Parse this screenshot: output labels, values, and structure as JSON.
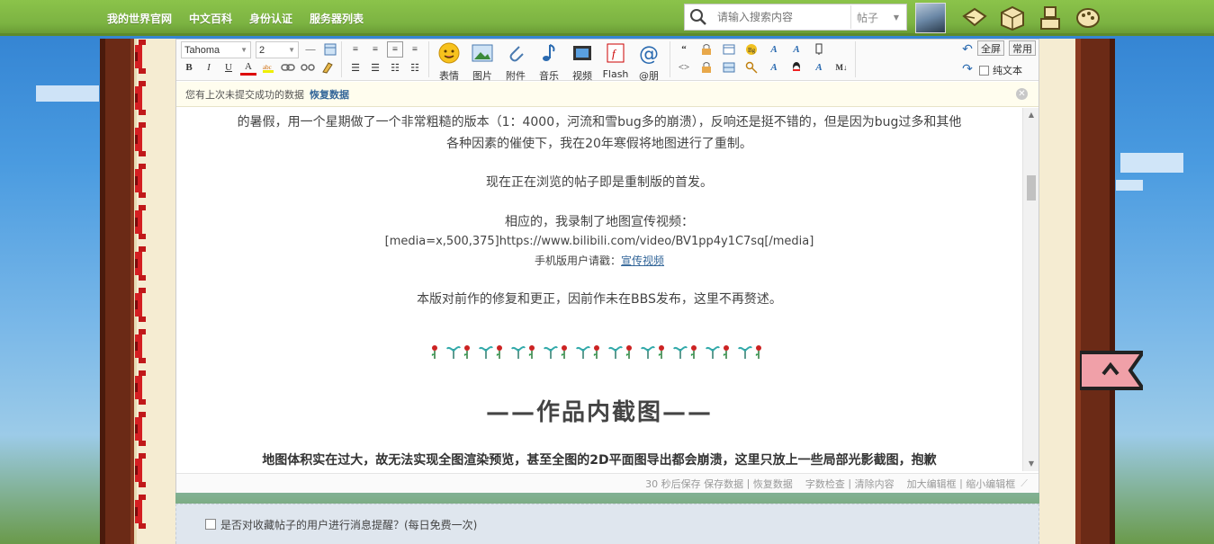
{
  "topnav": {
    "links": [
      "我的世界官网",
      "中文百科",
      "身份认证",
      "服务器列表"
    ],
    "search_placeholder": "请输入搜索内容",
    "search_scope": "帖子"
  },
  "toolbar": {
    "font_family": "Tahoma",
    "font_size": "2",
    "buttons": {
      "bold": "B",
      "italic": "I",
      "underline": "U",
      "color": "A"
    },
    "big_buttons": [
      "表情",
      "图片",
      "附件",
      "音乐",
      "视频",
      "Flash",
      "@朋"
    ],
    "fullscreen": "全屏",
    "common": "常用",
    "plain_text": "纯文本"
  },
  "notice": {
    "text": "您有上次未提交成功的数据",
    "restore": "恢复数据"
  },
  "content": {
    "para1_line1": "的暑假，用一个星期做了一个非常粗糙的版本（1：4000，河流和雪bug多的崩溃），反响还是挺不错的，但是因为bug过多和其他",
    "para1_line2": "各种因素的催使下，我在20年寒假将地图进行了重制。",
    "para2": "现在正在浏览的帖子即是重制版的首发。",
    "para3": "相应的，我录制了地图宣传视频：",
    "media": "[media=x,500,375]https://www.bilibili.com/video/BV1pp4y1C7sq[/media]",
    "mobile_prefix": "手机版用户请戳：",
    "mobile_link": "宣传视频",
    "para4": "本版对前作的修复和更正，因前作未在BBS发布，这里不再赘述。",
    "heading": "——作品内截图——",
    "para5_cut": "地图体积实在过大，故无法实现全图渲染预览，甚至全图的2D平面图导出都会崩溃，这里只放上一些局部光影截图，抱歉"
  },
  "statusbar": {
    "autosave": "30 秒后保存",
    "save": "保存数据",
    "sep": "|",
    "restore": "恢复数据",
    "wordcount": "字数检查",
    "clear": "清除内容",
    "enlarge": "加大编辑框",
    "shrink": "缩小编辑框"
  },
  "remind": {
    "label": "是否对收藏帖子的用户进行消息提醒？(每日免费一次)"
  },
  "colors": {
    "nav_green": "#7cb342",
    "frame_brown": "#6b2a16",
    "link_blue": "#336699"
  }
}
